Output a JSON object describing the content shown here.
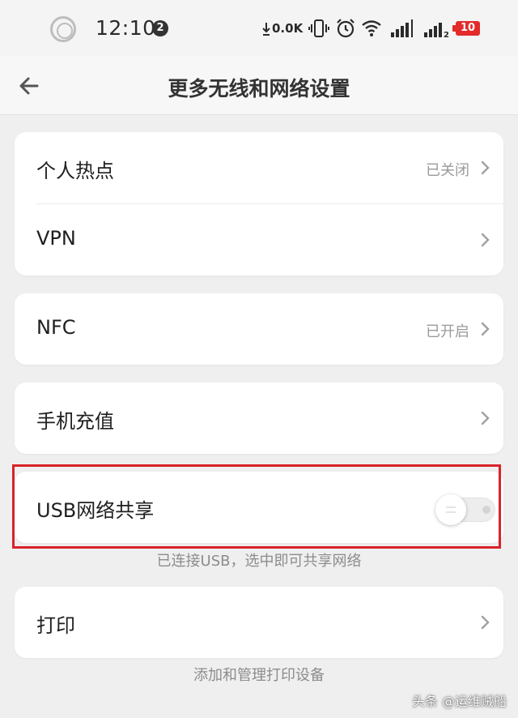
{
  "status_bar": {
    "time": "12:10",
    "notification_count": "2",
    "net_speed": "0.0K",
    "battery": "10",
    "battery_color": "#e32b2b"
  },
  "header": {
    "title": "更多无线和网络设置",
    "back_icon": "arrow-left-icon"
  },
  "settings": {
    "hotspot": {
      "label": "个人热点",
      "value": "已关闭"
    },
    "vpn": {
      "label": "VPN"
    },
    "nfc": {
      "label": "NFC",
      "value": "已开启"
    },
    "recharge": {
      "label": "手机充值"
    },
    "usb_tethering": {
      "label": "USB网络共享",
      "enabled": false,
      "hint": "已连接USB，选中即可共享网络"
    },
    "print": {
      "label": "打印",
      "hint": "添加和管理打印设备"
    }
  },
  "highlight_color": "#d9232a",
  "watermark": "头条 @运维贼船"
}
